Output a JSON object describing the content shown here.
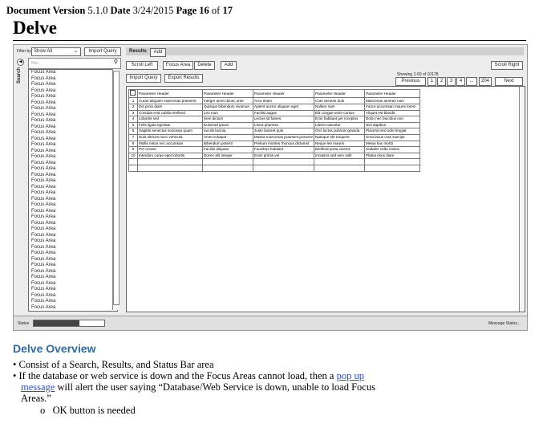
{
  "doc_header": {
    "version_label": "Document Version",
    "version": "5.1.0",
    "date_label": "Date",
    "date": "3/24/2015",
    "page_label": "Page",
    "page": "16",
    "of_label": "of",
    "total": "17"
  },
  "title": "Delve",
  "mock": {
    "filter_label": "Filter by",
    "filter_value": "Show All",
    "import_query": "Import Query",
    "search_tab": "Search",
    "search_placeholder": "filter",
    "focus_items": [
      "Focus Area",
      "Focus Area",
      "Focus Area",
      "Focus Area",
      "Focus Area",
      "Focus Area",
      "Focus Area",
      "Focus Area",
      "Focus Area",
      "Focus Area",
      "Focus Area",
      "Focus Area",
      "Focus Area",
      "Focus Area",
      "Focus Area",
      "Focus Area",
      "Focus Area",
      "Focus Area",
      "Focus Area",
      "Focus Area",
      "Focus Area",
      "Focus Area",
      "Focus Area",
      "Focus Area",
      "Focus Area",
      "Focus Area",
      "Focus Area",
      "Focus Area",
      "Focus Area",
      "Focus Area",
      "Focus Area",
      "Focus Area",
      "Focus Area",
      "Focus Area",
      "Focus Area",
      "Focus Area",
      "Focus Area",
      "Focus Area",
      "Focus Area",
      "Focus Area"
    ],
    "results_tab": "Results",
    "add_tab": "Add",
    "scroll_left": "Scroll Left",
    "focus_area_btn": "Focus Area",
    "delete": "Delete",
    "add": "Add",
    "scroll_right": "Scroll Right",
    "import_query2": "Import Query",
    "export_results": "Export Results",
    "showing": "Showing 1-50 of 10178",
    "prev": "Previous",
    "pages": [
      "1",
      "2",
      "3",
      "4",
      "...",
      "204"
    ],
    "next": "Next",
    "headers": [
      "Parameter Header",
      "Parameter Header",
      "Parameter Header",
      "Parameter Header",
      "Parameter Header"
    ],
    "rows": [
      [
        "1",
        "Curae aliquam maecenas praesent",
        "Integer amet donec ante",
        "Arcu etiam",
        "Cras aenean duis",
        "Maecenas aenean nam"
      ],
      [
        "2",
        "Dis proin diam",
        "Quisque bibendum vivamus",
        "Aptent auctor aliquam eget",
        "Nullam nam",
        "Fusce accumsan mauris lorem"
      ],
      [
        "3",
        "Conubia erat cubilia eleifend",
        "Leo mus",
        "Facilisi augue",
        "Elit congue enim cursus",
        "Aliquet est blandit"
      ],
      [
        "4",
        "Lobortis sed",
        "Sem dictum",
        "Lectus sit fames",
        "Eros habitant per inceptos",
        "Dolor nec faucibus non"
      ],
      [
        "5",
        "Felis ligula egestas",
        "Euismod ipsum",
        "Litora pharetra",
        "Libero nascetur",
        "Nisi dapibus"
      ],
      [
        "6",
        "Sagittis senectus sociosqu quam",
        "Iaculis lacinia",
        "Justo laoreet quis",
        "Orci luctus pulvinar gravida",
        "Placerat sed odio feugiat"
      ],
      [
        "7",
        "Duis ultrices nunc vehicula",
        "Amet volutpat",
        "Massa maecenas praesent posuere",
        "Natoque elit torquent",
        "Urna lacus cras suscipit"
      ],
      [
        "8",
        "Mollis netus nec accumsan",
        "Bibendum potenti",
        "Pretium montes rhoncus dictumst",
        "Neque leo mauris",
        "Metus hac morbi"
      ],
      [
        "9",
        "Per ornare",
        "Facilisi aliquam",
        "Faucibus habitant",
        "Eleifend porta viverra",
        "Sodales nulla nostra"
      ],
      [
        "10",
        "Interdum curae eget lobortis",
        "Donec elit integer",
        "Enim primis vel",
        "Inceptos sed sem velit",
        "Platea risus diam"
      ]
    ],
    "status_label": "Status",
    "progress_fraction": 0.65,
    "message_status": "Message Status..."
  },
  "overview_title": "Delve Overview",
  "bullets": {
    "b1": "Consist of a Search, Results, and Status Bar area",
    "b2_pre": "If the database or web service is down and the Focus Areas cannot load, then a ",
    "b2_link": "pop up message",
    "b2_post": " will alert the user saying “Database/Web Service is down, unable to load Focus Areas.”",
    "sub": "OK button is needed"
  }
}
